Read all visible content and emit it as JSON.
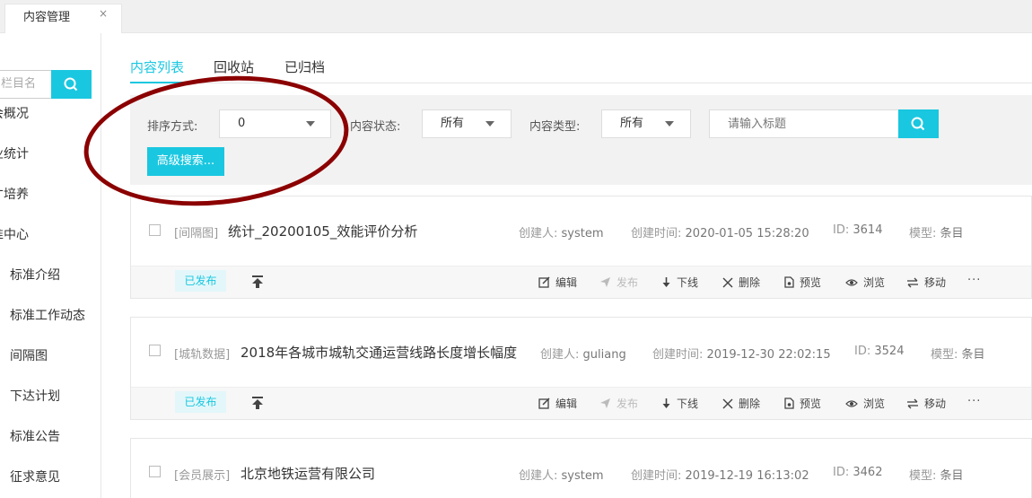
{
  "top_tabs": [
    {
      "label": "内容管理",
      "close": "×"
    }
  ],
  "sidebar": {
    "search_placeholder": "栏目名",
    "items": [
      {
        "label": "会概况"
      },
      {
        "label": "业统计"
      },
      {
        "label": "才培养"
      },
      {
        "label": "准中心"
      },
      {
        "label": "标准介绍"
      },
      {
        "label": "标准工作动态"
      },
      {
        "label": "间隔图"
      },
      {
        "label": "下达计划"
      },
      {
        "label": "标准公告"
      },
      {
        "label": "征求意见"
      }
    ]
  },
  "tabs": [
    {
      "label": "内容列表",
      "active": true
    },
    {
      "label": "回收站",
      "active": false
    },
    {
      "label": "已归档",
      "active": false
    }
  ],
  "filters": {
    "sort_label": "排序方式:",
    "sort_value": "0",
    "status_label": "内容状态:",
    "status_value": "所有",
    "type_label": "内容类型:",
    "type_value": "所有",
    "title_placeholder": "请输入标题",
    "advanced_label": "高级搜索..."
  },
  "meta_labels": {
    "creator": "创建人:",
    "created_time": "创建时间:",
    "id": "ID:",
    "model": "模型:"
  },
  "actions": {
    "edit": "编辑",
    "publish": "发布",
    "offline": "下线",
    "delete": "删除",
    "preview": "预览",
    "browse": "浏览",
    "move": "移动",
    "more": "···"
  },
  "items": [
    {
      "category": "[间隔图]",
      "title": "统计_20200105_效能评价分析",
      "creator": "system",
      "created_time": "2020-01-05 15:28:20",
      "id": "3614",
      "model": "条目",
      "status": "已发布"
    },
    {
      "category": "[城轨数据]",
      "title": "2018年各城市城轨交通运营线路长度增长幅度",
      "creator": "guliang",
      "created_time": "2019-12-30 22:02:15",
      "id": "3524",
      "model": "条目",
      "status": "已发布"
    },
    {
      "category": "[会员展示]",
      "title": "北京地铁运营有限公司",
      "creator": "system",
      "created_time": "2019-12-19 16:13:02",
      "id": "3462",
      "model": "条目",
      "status": ""
    }
  ],
  "colors": {
    "accent": "#1ac7e0",
    "annotation": "#8b0000"
  }
}
